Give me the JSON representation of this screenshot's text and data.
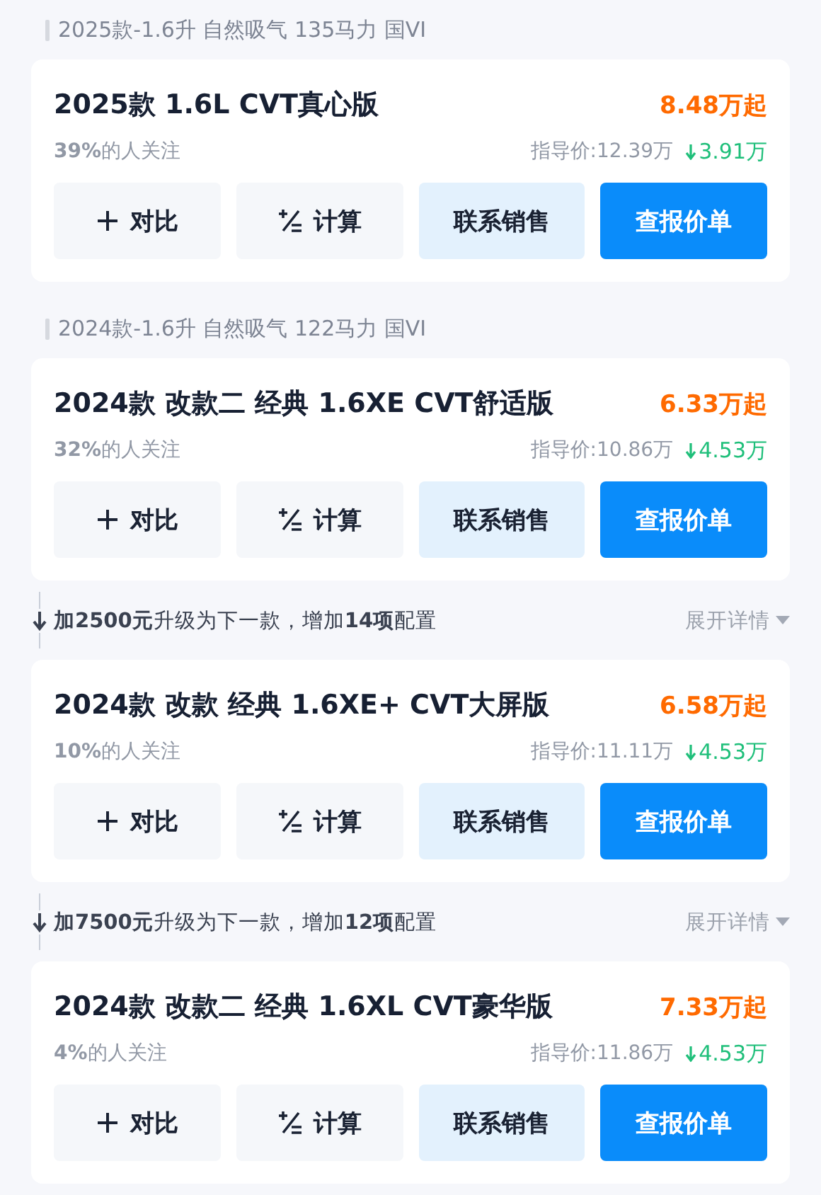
{
  "items": [
    {
      "kind": "header",
      "text": "2025款-1.6升 自然吸气 135马力 国VI"
    },
    {
      "kind": "card",
      "title": "2025款 1.6L CVT真心版",
      "price": "8.48万起",
      "attention": "**39%**的人关注",
      "guide_price": "指导价:12.39万",
      "discount": "3.91万",
      "buttons": [
        {
          "kind": "compare",
          "label": "对比"
        },
        {
          "kind": "calc",
          "label": "计算"
        },
        {
          "kind": "contact",
          "label": "联系销售"
        },
        {
          "kind": "quote",
          "label": "查报价单"
        }
      ]
    },
    {
      "kind": "header",
      "text": "2024款-1.6升 自然吸气 122马力 国VI"
    },
    {
      "kind": "card",
      "title": "2024款 改款二 经典 1.6XE CVT舒适版",
      "price": "6.33万起",
      "attention": "**32%**的人关注",
      "guide_price": "指导价:10.86万",
      "discount": "4.53万",
      "buttons": [
        {
          "kind": "compare",
          "label": "对比"
        },
        {
          "kind": "calc",
          "label": "计算"
        },
        {
          "kind": "contact",
          "label": "联系销售"
        },
        {
          "kind": "quote",
          "label": "查报价单"
        }
      ]
    },
    {
      "kind": "upgrade",
      "text": "**加2500元**升级为下一款，增加**14项**配置",
      "link": "展开详情"
    },
    {
      "kind": "card",
      "title": "2024款 改款 经典 1.6XE+ CVT大屏版",
      "price": "6.58万起",
      "attention": "**10%**的人关注",
      "guide_price": "指导价:11.11万",
      "discount": "4.53万",
      "buttons": [
        {
          "kind": "compare",
          "label": "对比"
        },
        {
          "kind": "calc",
          "label": "计算"
        },
        {
          "kind": "contact",
          "label": "联系销售"
        },
        {
          "kind": "quote",
          "label": "查报价单"
        }
      ]
    },
    {
      "kind": "upgrade",
      "text": "**加7500元**升级为下一款，增加**12项**配置",
      "link": "展开详情"
    },
    {
      "kind": "card",
      "title": "2024款 改款二 经典 1.6XL CVT豪华版",
      "price": "7.33万起",
      "attention": "**4%**的人关注",
      "guide_price": "指导价:11.86万",
      "discount": "4.53万",
      "buttons": [
        {
          "kind": "compare",
          "label": "对比"
        },
        {
          "kind": "calc",
          "label": "计算"
        },
        {
          "kind": "contact",
          "label": "联系销售"
        },
        {
          "kind": "quote",
          "label": "查报价单"
        }
      ]
    }
  ]
}
